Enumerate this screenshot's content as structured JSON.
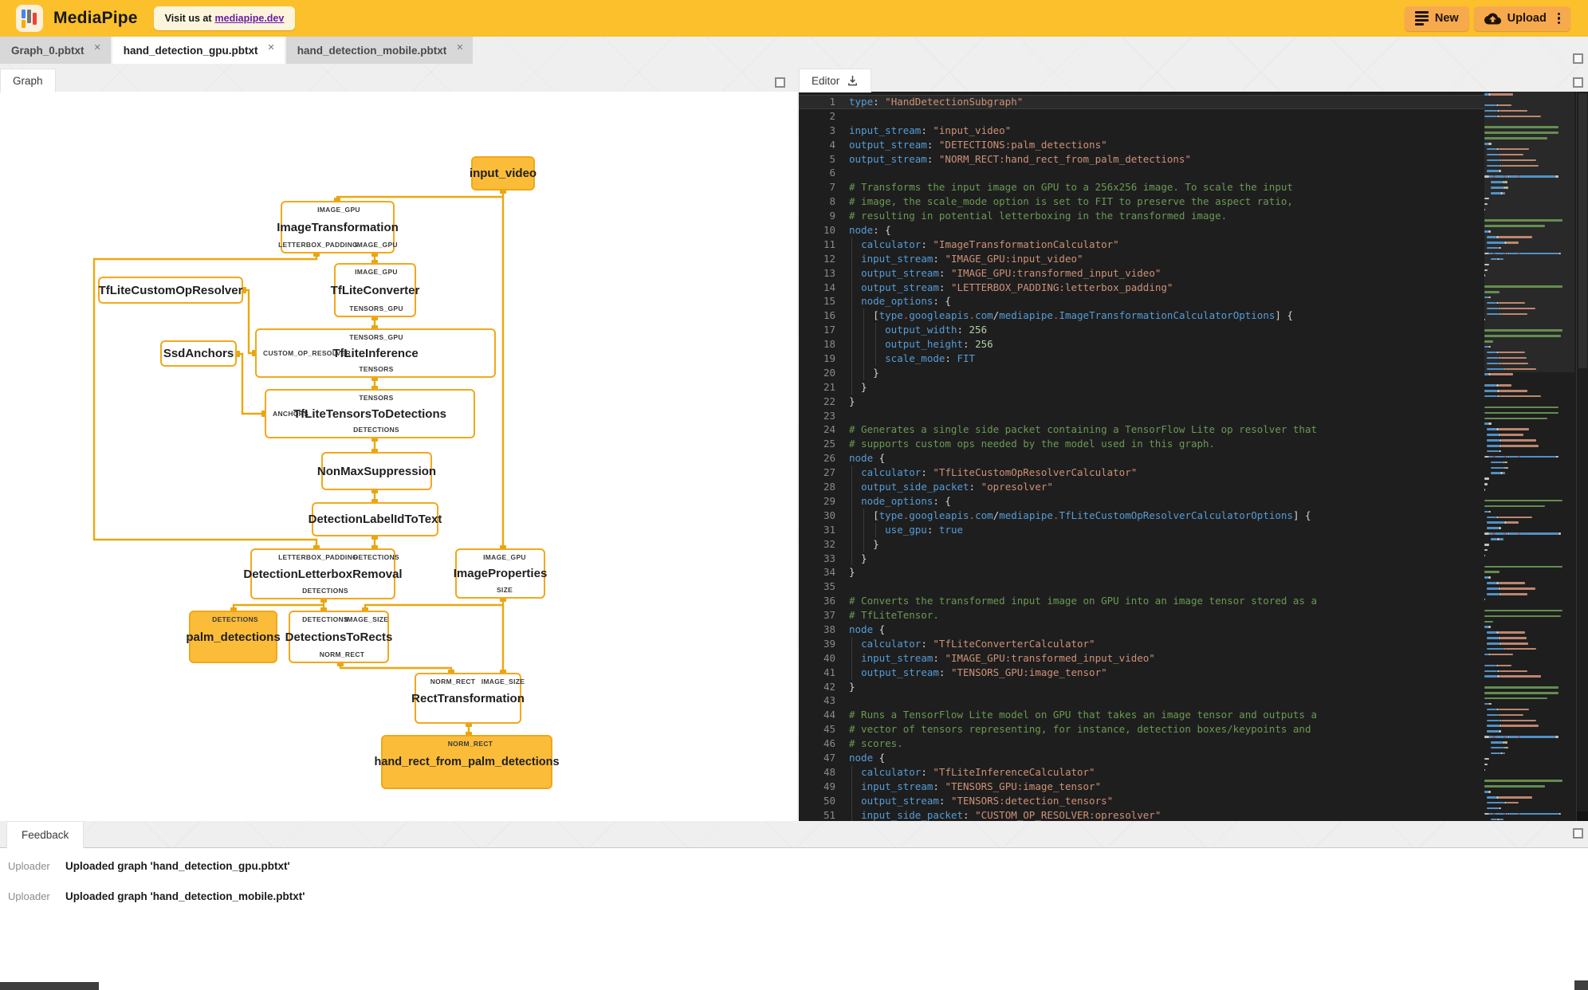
{
  "header": {
    "title": "MediaPipe",
    "visit_text": "Visit us at",
    "visit_link": "mediapipe.dev",
    "new_label": "New",
    "upload_label": "Upload"
  },
  "file_tabs": [
    {
      "label": "Graph_0.pbtxt",
      "active": false
    },
    {
      "label": "hand_detection_gpu.pbtxt",
      "active": true
    },
    {
      "label": "hand_detection_mobile.pbtxt",
      "active": false
    }
  ],
  "graph_panel": {
    "tab_label": "Graph",
    "nodes": [
      {
        "id": "input_video",
        "label": "input_video",
        "kind": "stream",
        "ports_top": [],
        "ports_bottom": [],
        "port_left": ""
      },
      {
        "id": "ImageTransformation",
        "label": "ImageTransformation",
        "kind": "calculator",
        "ports_top": [
          "IMAGE_GPU"
        ],
        "ports_bottom": [
          "LETTERBOX_PADDING",
          "IMAGE_GPU"
        ],
        "port_left": ""
      },
      {
        "id": "TfLiteConverter",
        "label": "TfLiteConverter",
        "kind": "calculator",
        "ports_top": [
          "IMAGE_GPU"
        ],
        "ports_bottom": [
          "TENSORS_GPU"
        ],
        "port_left": ""
      },
      {
        "id": "TfLiteCustomOpResolver",
        "label": "TfLiteCustomOpResolver",
        "kind": "calculator",
        "ports_top": [],
        "ports_bottom": [],
        "port_left": ""
      },
      {
        "id": "TfLiteInference",
        "label": "TfLiteInference",
        "kind": "calculator",
        "ports_top": [
          "TENSORS_GPU"
        ],
        "ports_bottom": [
          "TENSORS"
        ],
        "port_left": "CUSTOM_OP_RESOLVER"
      },
      {
        "id": "SsdAnchors",
        "label": "SsdAnchors",
        "kind": "calculator",
        "ports_top": [],
        "ports_bottom": [],
        "port_left": ""
      },
      {
        "id": "TfLiteTensorsToDetections",
        "label": "TfLiteTensorsToDetections",
        "kind": "calculator",
        "ports_top": [
          "TENSORS"
        ],
        "ports_bottom": [
          "DETECTIONS"
        ],
        "port_left": "ANCHORS"
      },
      {
        "id": "NonMaxSuppression",
        "label": "NonMaxSuppression",
        "kind": "calculator",
        "ports_top": [],
        "ports_bottom": [],
        "port_left": ""
      },
      {
        "id": "DetectionLabelIdToText",
        "label": "DetectionLabelIdToText",
        "kind": "calculator",
        "ports_top": [],
        "ports_bottom": [],
        "port_left": ""
      },
      {
        "id": "DetectionLetterboxRemoval",
        "label": "DetectionLetterboxRemoval",
        "kind": "calculator",
        "ports_top": [
          "LETTERBOX_PADDING",
          "DETECTIONS"
        ],
        "ports_bottom": [
          "DETECTIONS"
        ],
        "port_left": ""
      },
      {
        "id": "ImageProperties",
        "label": "ImageProperties",
        "kind": "calculator",
        "ports_top": [
          "IMAGE_GPU"
        ],
        "ports_bottom": [
          "SIZE"
        ],
        "port_left": ""
      },
      {
        "id": "palm_detections",
        "label": "palm_detections",
        "kind": "stream",
        "ports_top": [
          "DETECTIONS"
        ],
        "ports_bottom": [],
        "port_left": ""
      },
      {
        "id": "DetectionsToRects",
        "label": "DetectionsToRects",
        "kind": "calculator",
        "ports_top": [
          "DETECTIONS",
          "IMAGE_SIZE"
        ],
        "ports_bottom": [
          "NORM_RECT"
        ],
        "port_left": ""
      },
      {
        "id": "RectTransformation",
        "label": "RectTransformation",
        "kind": "calculator",
        "ports_top": [
          "NORM_RECT",
          "IMAGE_SIZE"
        ],
        "ports_bottom": [],
        "port_left": ""
      },
      {
        "id": "hand_rect_from_palm_detections",
        "label": "hand_rect_from_palm_detections",
        "kind": "stream",
        "ports_top": [
          "NORM_RECT"
        ],
        "ports_bottom": [],
        "port_left": ""
      }
    ]
  },
  "editor": {
    "tab_label": "Editor",
    "lines": [
      [
        [
          "k",
          "type"
        ],
        [
          "p",
          ": "
        ],
        [
          "s",
          "\"HandDetectionSubgraph\""
        ]
      ],
      [],
      [
        [
          "k",
          "input_stream"
        ],
        [
          "p",
          ": "
        ],
        [
          "s",
          "\"input_video\""
        ]
      ],
      [
        [
          "k",
          "output_stream"
        ],
        [
          "p",
          ": "
        ],
        [
          "s",
          "\"DETECTIONS:palm_detections\""
        ]
      ],
      [
        [
          "k",
          "output_stream"
        ],
        [
          "p",
          ": "
        ],
        [
          "s",
          "\"NORM_RECT:hand_rect_from_palm_detections\""
        ]
      ],
      [],
      [
        [
          "c",
          "# Transforms the input image on GPU to a 256x256 image. To scale the input"
        ]
      ],
      [
        [
          "c",
          "# image, the scale_mode option is set to FIT to preserve the aspect ratio,"
        ]
      ],
      [
        [
          "c",
          "# resulting in potential letterboxing in the transformed image."
        ]
      ],
      [
        [
          "k",
          "node"
        ],
        [
          "p",
          ": {"
        ]
      ],
      [
        [
          "p",
          "  "
        ],
        [
          "k",
          "calculator"
        ],
        [
          "p",
          ": "
        ],
        [
          "s",
          "\"ImageTransformationCalculator\""
        ]
      ],
      [
        [
          "p",
          "  "
        ],
        [
          "k",
          "input_stream"
        ],
        [
          "p",
          ": "
        ],
        [
          "s",
          "\"IMAGE_GPU:input_video\""
        ]
      ],
      [
        [
          "p",
          "  "
        ],
        [
          "k",
          "output_stream"
        ],
        [
          "p",
          ": "
        ],
        [
          "s",
          "\"IMAGE_GPU:transformed_input_video\""
        ]
      ],
      [
        [
          "p",
          "  "
        ],
        [
          "k",
          "output_stream"
        ],
        [
          "p",
          ": "
        ],
        [
          "s",
          "\"LETTERBOX_PADDING:letterbox_padding\""
        ]
      ],
      [
        [
          "p",
          "  "
        ],
        [
          "k",
          "node_options"
        ],
        [
          "p",
          ": {"
        ]
      ],
      [
        [
          "p",
          "    ["
        ],
        [
          "k",
          "type"
        ],
        [
          "d",
          "."
        ],
        [
          "k",
          "googleapis"
        ],
        [
          "d",
          "."
        ],
        [
          "k",
          "com"
        ],
        [
          "p",
          "/"
        ],
        [
          "k",
          "mediapipe"
        ],
        [
          "d",
          "."
        ],
        [
          "k",
          "ImageTransformationCalculatorOptions"
        ],
        [
          "p",
          "] {"
        ]
      ],
      [
        [
          "p",
          "      "
        ],
        [
          "k",
          "output_width"
        ],
        [
          "p",
          ": "
        ],
        [
          "n",
          "256"
        ]
      ],
      [
        [
          "p",
          "      "
        ],
        [
          "k",
          "output_height"
        ],
        [
          "p",
          ": "
        ],
        [
          "n",
          "256"
        ]
      ],
      [
        [
          "p",
          "      "
        ],
        [
          "k",
          "scale_mode"
        ],
        [
          "p",
          ": "
        ],
        [
          "b",
          "FIT"
        ]
      ],
      [
        [
          "p",
          "    }"
        ]
      ],
      [
        [
          "p",
          "  }"
        ]
      ],
      [
        [
          "p",
          "}"
        ]
      ],
      [],
      [
        [
          "c",
          "# Generates a single side packet containing a TensorFlow Lite op resolver that"
        ]
      ],
      [
        [
          "c",
          "# supports custom ops needed by the model used in this graph."
        ]
      ],
      [
        [
          "k",
          "node"
        ],
        [
          "p",
          " {"
        ]
      ],
      [
        [
          "p",
          "  "
        ],
        [
          "k",
          "calculator"
        ],
        [
          "p",
          ": "
        ],
        [
          "s",
          "\"TfLiteCustomOpResolverCalculator\""
        ]
      ],
      [
        [
          "p",
          "  "
        ],
        [
          "k",
          "output_side_packet"
        ],
        [
          "p",
          ": "
        ],
        [
          "s",
          "\"opresolver\""
        ]
      ],
      [
        [
          "p",
          "  "
        ],
        [
          "k",
          "node_options"
        ],
        [
          "p",
          ": {"
        ]
      ],
      [
        [
          "p",
          "    ["
        ],
        [
          "k",
          "type"
        ],
        [
          "d",
          "."
        ],
        [
          "k",
          "googleapis"
        ],
        [
          "d",
          "."
        ],
        [
          "k",
          "com"
        ],
        [
          "p",
          "/"
        ],
        [
          "k",
          "mediapipe"
        ],
        [
          "d",
          "."
        ],
        [
          "k",
          "TfLiteCustomOpResolverCalculatorOptions"
        ],
        [
          "p",
          "] {"
        ]
      ],
      [
        [
          "p",
          "      "
        ],
        [
          "k",
          "use_gpu"
        ],
        [
          "p",
          ": "
        ],
        [
          "b",
          "true"
        ]
      ],
      [
        [
          "p",
          "    }"
        ]
      ],
      [
        [
          "p",
          "  }"
        ]
      ],
      [
        [
          "p",
          "}"
        ]
      ],
      [],
      [
        [
          "c",
          "# Converts the transformed input image on GPU into an image tensor stored as a"
        ]
      ],
      [
        [
          "c",
          "# TfLiteTensor."
        ]
      ],
      [
        [
          "k",
          "node"
        ],
        [
          "p",
          " {"
        ]
      ],
      [
        [
          "p",
          "  "
        ],
        [
          "k",
          "calculator"
        ],
        [
          "p",
          ": "
        ],
        [
          "s",
          "\"TfLiteConverterCalculator\""
        ]
      ],
      [
        [
          "p",
          "  "
        ],
        [
          "k",
          "input_stream"
        ],
        [
          "p",
          ": "
        ],
        [
          "s",
          "\"IMAGE_GPU:transformed_input_video\""
        ]
      ],
      [
        [
          "p",
          "  "
        ],
        [
          "k",
          "output_stream"
        ],
        [
          "p",
          ": "
        ],
        [
          "s",
          "\"TENSORS_GPU:image_tensor\""
        ]
      ],
      [
        [
          "p",
          "}"
        ]
      ],
      [],
      [
        [
          "c",
          "# Runs a TensorFlow Lite model on GPU that takes an image tensor and outputs a"
        ]
      ],
      [
        [
          "c",
          "# vector of tensors representing, for instance, detection boxes/keypoints and"
        ]
      ],
      [
        [
          "c",
          "# scores."
        ]
      ],
      [
        [
          "k",
          "node"
        ],
        [
          "p",
          " {"
        ]
      ],
      [
        [
          "p",
          "  "
        ],
        [
          "k",
          "calculator"
        ],
        [
          "p",
          ": "
        ],
        [
          "s",
          "\"TfLiteInferenceCalculator\""
        ]
      ],
      [
        [
          "p",
          "  "
        ],
        [
          "k",
          "input_stream"
        ],
        [
          "p",
          ": "
        ],
        [
          "s",
          "\"TENSORS_GPU:image_tensor\""
        ]
      ],
      [
        [
          "p",
          "  "
        ],
        [
          "k",
          "output_stream"
        ],
        [
          "p",
          ": "
        ],
        [
          "s",
          "\"TENSORS:detection_tensors\""
        ]
      ],
      [
        [
          "p",
          "  "
        ],
        [
          "k",
          "input_side_packet"
        ],
        [
          "p",
          ": "
        ],
        [
          "s",
          "\"CUSTOM_OP_RESOLVER:opresolver\""
        ]
      ]
    ]
  },
  "feedback": {
    "tab_label": "Feedback",
    "rows": [
      {
        "source": "Uploader",
        "message": "Uploaded graph 'hand_detection_gpu.pbtxt'"
      },
      {
        "source": "Uploader",
        "message": "Uploaded graph 'hand_detection_mobile.pbtxt'"
      }
    ]
  },
  "colors": {
    "header_bg": "#FCC02D",
    "header_button_bg": "#F7A94E",
    "link": "#681DA8",
    "node_border": "#F2A81C",
    "node_fill_stream": "#FBBC3A",
    "edge": "#ECA70F",
    "editor_bg": "#1E1E1E",
    "token_key": "#569CD6",
    "token_string": "#CE9178",
    "token_comment": "#6A9955",
    "token_number": "#B5CEA8",
    "token_punct": "#D4D4D4",
    "token_dot": "#E25A50"
  }
}
